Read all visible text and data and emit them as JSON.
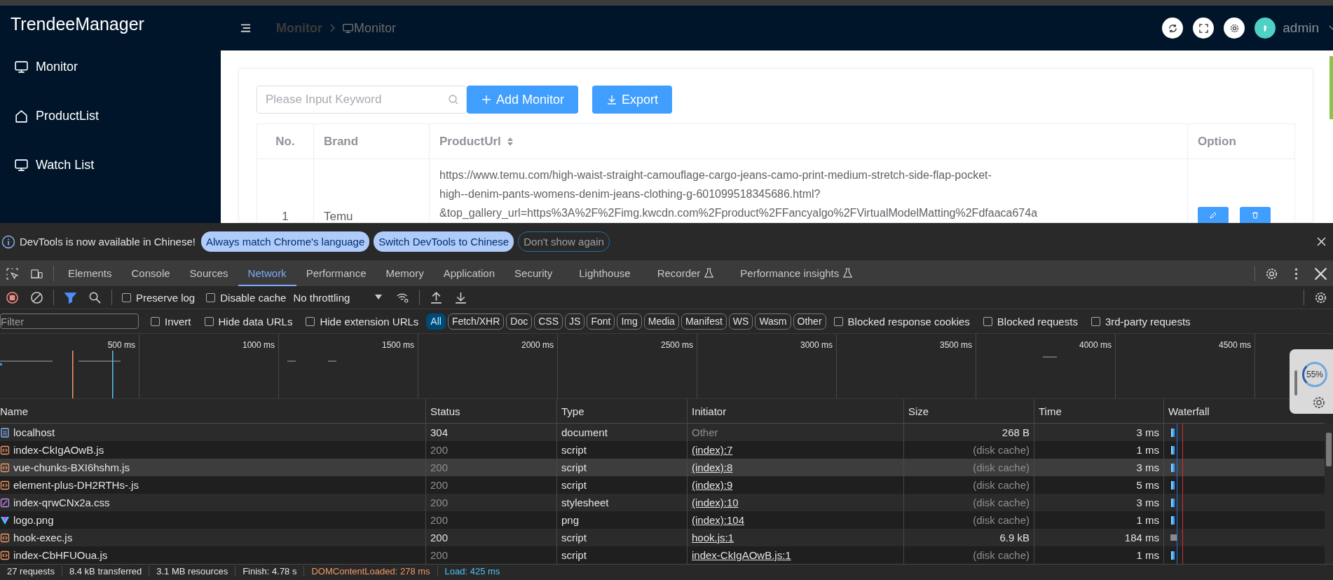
{
  "app": {
    "title": "TrendeeManager",
    "sidebar": {
      "items": [
        {
          "label": "Monitor"
        },
        {
          "label": "ProductList"
        },
        {
          "label": "Watch List"
        }
      ]
    },
    "breadcrumb": [
      {
        "label": "Monitor"
      },
      {
        "label": "Monitor"
      }
    ],
    "user": "admin",
    "search": {
      "placeholder": "Please Input Keyword"
    },
    "buttons": [
      {
        "label": "Add Monitor"
      },
      {
        "label": "Export"
      }
    ],
    "table": {
      "columns": [
        {
          "label": "No.",
          "sortable": false
        },
        {
          "label": "Brand",
          "sortable": false
        },
        {
          "label": "ProductUrl",
          "sortable": true
        },
        {
          "label": "Option",
          "sortable": false
        }
      ],
      "rows": [
        {
          "no": "1",
          "brand": "Temu",
          "product_url": "https://www.temu.com/high-waist-straight-camouflage-cargo-jeans-camo-print-medium-stretch-side-flap-pocket-\nhigh--denim-pants-womens-denim-jeans-clothing-g-601099518345686.html?\n&top_gallery_url=https%3A%2F%2Fimg.kwcdn.com%2Fproduct%2FFancyalgo%2FVirtualModelMatting%2Fdfaaca674a"
        }
      ]
    }
  },
  "devtools": {
    "infobar": {
      "message": "DevTools is now available in Chinese!",
      "buttons": [
        {
          "label": "Always match Chrome's language",
          "kind": "primary"
        },
        {
          "label": "Switch DevTools to Chinese",
          "kind": "primary"
        },
        {
          "label": "Don't show again",
          "kind": "outline"
        }
      ]
    },
    "tabs": [
      {
        "label": "Elements",
        "selected": false,
        "experimental": false
      },
      {
        "label": "Console",
        "selected": false,
        "experimental": false
      },
      {
        "label": "Sources",
        "selected": false,
        "experimental": false
      },
      {
        "label": "Network",
        "selected": true,
        "experimental": false
      },
      {
        "label": "Performance",
        "selected": false,
        "experimental": false
      },
      {
        "label": "Memory",
        "selected": false,
        "experimental": false
      },
      {
        "label": "Application",
        "selected": false,
        "experimental": false
      },
      {
        "label": "Security",
        "selected": false,
        "experimental": false
      },
      {
        "label": "Lighthouse",
        "selected": false,
        "experimental": false
      },
      {
        "label": "Recorder",
        "selected": false,
        "experimental": true
      },
      {
        "label": "Performance insights",
        "selected": false,
        "experimental": true
      }
    ],
    "toolbar": {
      "filter_on": true,
      "checkboxes": [
        {
          "label": "Preserve log",
          "checked": false
        },
        {
          "label": "Disable cache",
          "checked": false
        }
      ],
      "throttling": "No throttling"
    },
    "filter_bar": {
      "placeholder": "Filter",
      "options": [
        {
          "label": "Invert",
          "checked": false
        },
        {
          "label": "Hide data URLs",
          "checked": false
        },
        {
          "label": "Hide extension URLs",
          "checked": false
        }
      ],
      "types": [
        {
          "label": "All",
          "selected": true
        },
        {
          "label": "Fetch/XHR",
          "selected": false
        },
        {
          "label": "Doc",
          "selected": false
        },
        {
          "label": "CSS",
          "selected": false
        },
        {
          "label": "JS",
          "selected": false
        },
        {
          "label": "Font",
          "selected": false
        },
        {
          "label": "Img",
          "selected": false
        },
        {
          "label": "Media",
          "selected": false
        },
        {
          "label": "Manifest",
          "selected": false
        },
        {
          "label": "WS",
          "selected": false
        },
        {
          "label": "Wasm",
          "selected": false
        },
        {
          "label": "Other",
          "selected": false
        }
      ],
      "more_options": [
        {
          "label": "Blocked response cookies",
          "checked": false
        },
        {
          "label": "Blocked requests",
          "checked": false
        },
        {
          "label": "3rd-party requests",
          "checked": false
        }
      ]
    },
    "timeline": {
      "ticks": [
        "500 ms",
        "1000 ms",
        "1500 ms",
        "2000 ms",
        "2500 ms",
        "3000 ms",
        "3500 ms",
        "4000 ms",
        "4500 ms"
      ]
    },
    "requests": {
      "columns": [
        "Name",
        "Status",
        "Type",
        "Initiator",
        "Size",
        "Time",
        "Waterfall"
      ],
      "rows": [
        {
          "name": "localhost",
          "kind": "document",
          "status": "304",
          "cached": false,
          "type": "document",
          "initiator": "Other",
          "initiator_link": false,
          "size": "268 B",
          "time": "3 ms",
          "highlighted": false
        },
        {
          "name": "index-CkIgAOwB.js",
          "kind": "script",
          "status": "200",
          "cached": true,
          "type": "script",
          "initiator": "(index):7",
          "initiator_link": true,
          "size": "(disk cache)",
          "time": "1 ms",
          "highlighted": false
        },
        {
          "name": "vue-chunks-BXI6hshm.js",
          "kind": "script",
          "status": "200",
          "cached": true,
          "type": "script",
          "initiator": "(index):8",
          "initiator_link": true,
          "size": "(disk cache)",
          "time": "3 ms",
          "highlighted": true
        },
        {
          "name": "element-plus-DH2RTHs-.js",
          "kind": "script",
          "status": "200",
          "cached": true,
          "type": "script",
          "initiator": "(index):9",
          "initiator_link": true,
          "size": "(disk cache)",
          "time": "5 ms",
          "highlighted": false
        },
        {
          "name": "index-qrwCNx2a.css",
          "kind": "stylesheet",
          "status": "200",
          "cached": true,
          "type": "stylesheet",
          "initiator": "(index):10",
          "initiator_link": true,
          "size": "(disk cache)",
          "time": "3 ms",
          "highlighted": false
        },
        {
          "name": "logo.png",
          "kind": "image",
          "status": "200",
          "cached": true,
          "type": "png",
          "initiator": "(index):104",
          "initiator_link": true,
          "size": "(disk cache)",
          "time": "1 ms",
          "highlighted": false
        },
        {
          "name": "hook-exec.js",
          "kind": "script",
          "status": "200",
          "cached": false,
          "type": "script",
          "initiator": "hook.js:1",
          "initiator_link": true,
          "size": "6.9 kB",
          "time": "184 ms",
          "highlighted": false
        },
        {
          "name": "index-CbHFUOua.js",
          "kind": "script",
          "status": "200",
          "cached": true,
          "type": "script",
          "initiator": "index-CkIgAOwB.js:1",
          "initiator_link": true,
          "size": "(disk cache)",
          "time": "1 ms",
          "highlighted": false
        }
      ]
    },
    "summary": [
      {
        "text": "27 requests",
        "kind": "plain"
      },
      {
        "text": "8.4 kB transferred",
        "kind": "plain"
      },
      {
        "text": "3.1 MB resources",
        "kind": "plain"
      },
      {
        "text": "Finish: 4.78 s",
        "kind": "plain"
      },
      {
        "text": "DOMContentLoaded: 278 ms",
        "kind": "dcl"
      },
      {
        "text": "Load: 425 ms",
        "kind": "load"
      }
    ],
    "overlay": {
      "percent": "55%"
    }
  }
}
